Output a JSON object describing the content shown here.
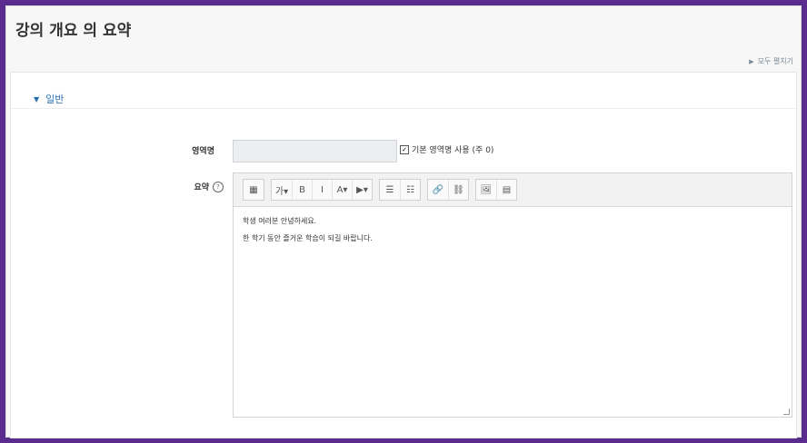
{
  "page": {
    "title": "강의 개요 의 요약",
    "expand_all": "모두 펼치기"
  },
  "section": {
    "label": "일반"
  },
  "form": {
    "section_name_label": "영역명",
    "use_default_label": "기본 영역명 사용 (주 0)",
    "summary_label": "요약"
  },
  "editor": {
    "toolbar": [
      [
        "▦"
      ],
      [
        "가▾",
        "B",
        "I",
        "A▾",
        "▶▾"
      ],
      [
        "☰",
        "☷"
      ],
      [
        "🔗",
        "⛓"
      ],
      [
        "🖼",
        "▤"
      ]
    ],
    "content_lines": [
      "학생 여러분 안녕하세요.",
      "한 학기 동안 즐거운 학습이 되길 바랍니다."
    ]
  }
}
